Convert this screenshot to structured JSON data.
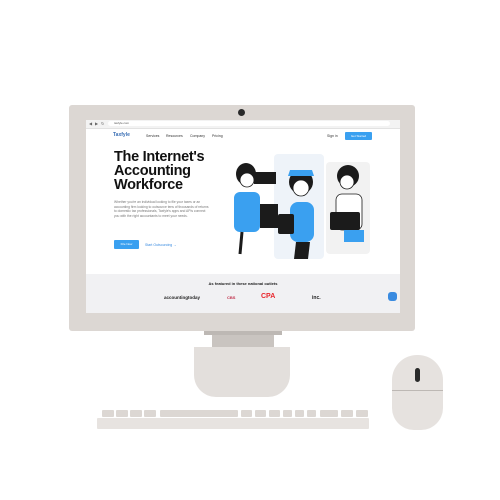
{
  "browser": {
    "url": "taxfyle.com",
    "back_icon": "arrow-left-icon",
    "forward_icon": "arrow-right-icon",
    "reload_icon": "reload-icon"
  },
  "site": {
    "logo_text": "Taxfyle",
    "nav": [
      "Services",
      "Resources",
      "Company",
      "Pricing"
    ],
    "signin": "Sign in",
    "cta_top": "Get Started",
    "hero": {
      "title": "The Internet's Accounting Workforce",
      "body": "Whether you're an individual looking to file your taxes or an accounting firm looking to outsource tens of thousands of returns to domestic tax professionals, Taxfyle's apps and APIs connect you with the right accountants to meet your needs.",
      "cta_main": "File Now",
      "cta_link": "Start Outsourcing →"
    },
    "featured": {
      "title": "As featured in these national outlets",
      "outlets": [
        "accountingtoday",
        "CBS",
        "CPA",
        "inc."
      ]
    },
    "chat_icon": "chat-icon"
  },
  "colors": {
    "accent": "#3aa0f0",
    "hardware": "#dcd7d3"
  }
}
